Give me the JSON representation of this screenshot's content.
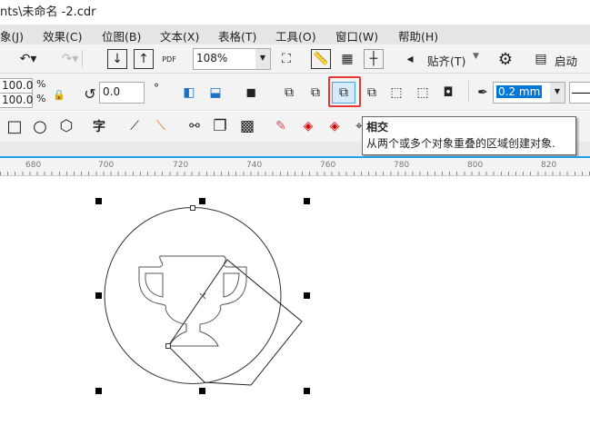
{
  "window": {
    "title": "nts\\未命名 -2.cdr"
  },
  "menu": [
    "象(J)",
    "效果(C)",
    "位图(B)",
    "文本(X)",
    "表格(T)",
    "工具(O)",
    "窗口(W)",
    "帮助(H)"
  ],
  "toolbar": {
    "zoom": "108%",
    "snap": "贴齐(T)",
    "launch": "启动",
    "pdf": "PDF"
  },
  "property_bar": {
    "scale_x": "100.0",
    "scale_y": "100.0",
    "percent": "%",
    "rotation": "0.0",
    "degree": "°",
    "outline_width": "0.2 mm"
  },
  "tooltip": {
    "title": "相交",
    "description": "从两个或多个对象重叠的区域创建对象."
  },
  "toolbox": {
    "text_tool": "字"
  },
  "ruler": {
    "ticks": [
      "680",
      "700",
      "720",
      "740",
      "760",
      "780",
      "800",
      "820"
    ]
  },
  "colors": {
    "accent": "#1ea0ea",
    "highlight_border": "#e53935",
    "selection_bg": "#0078d7"
  }
}
